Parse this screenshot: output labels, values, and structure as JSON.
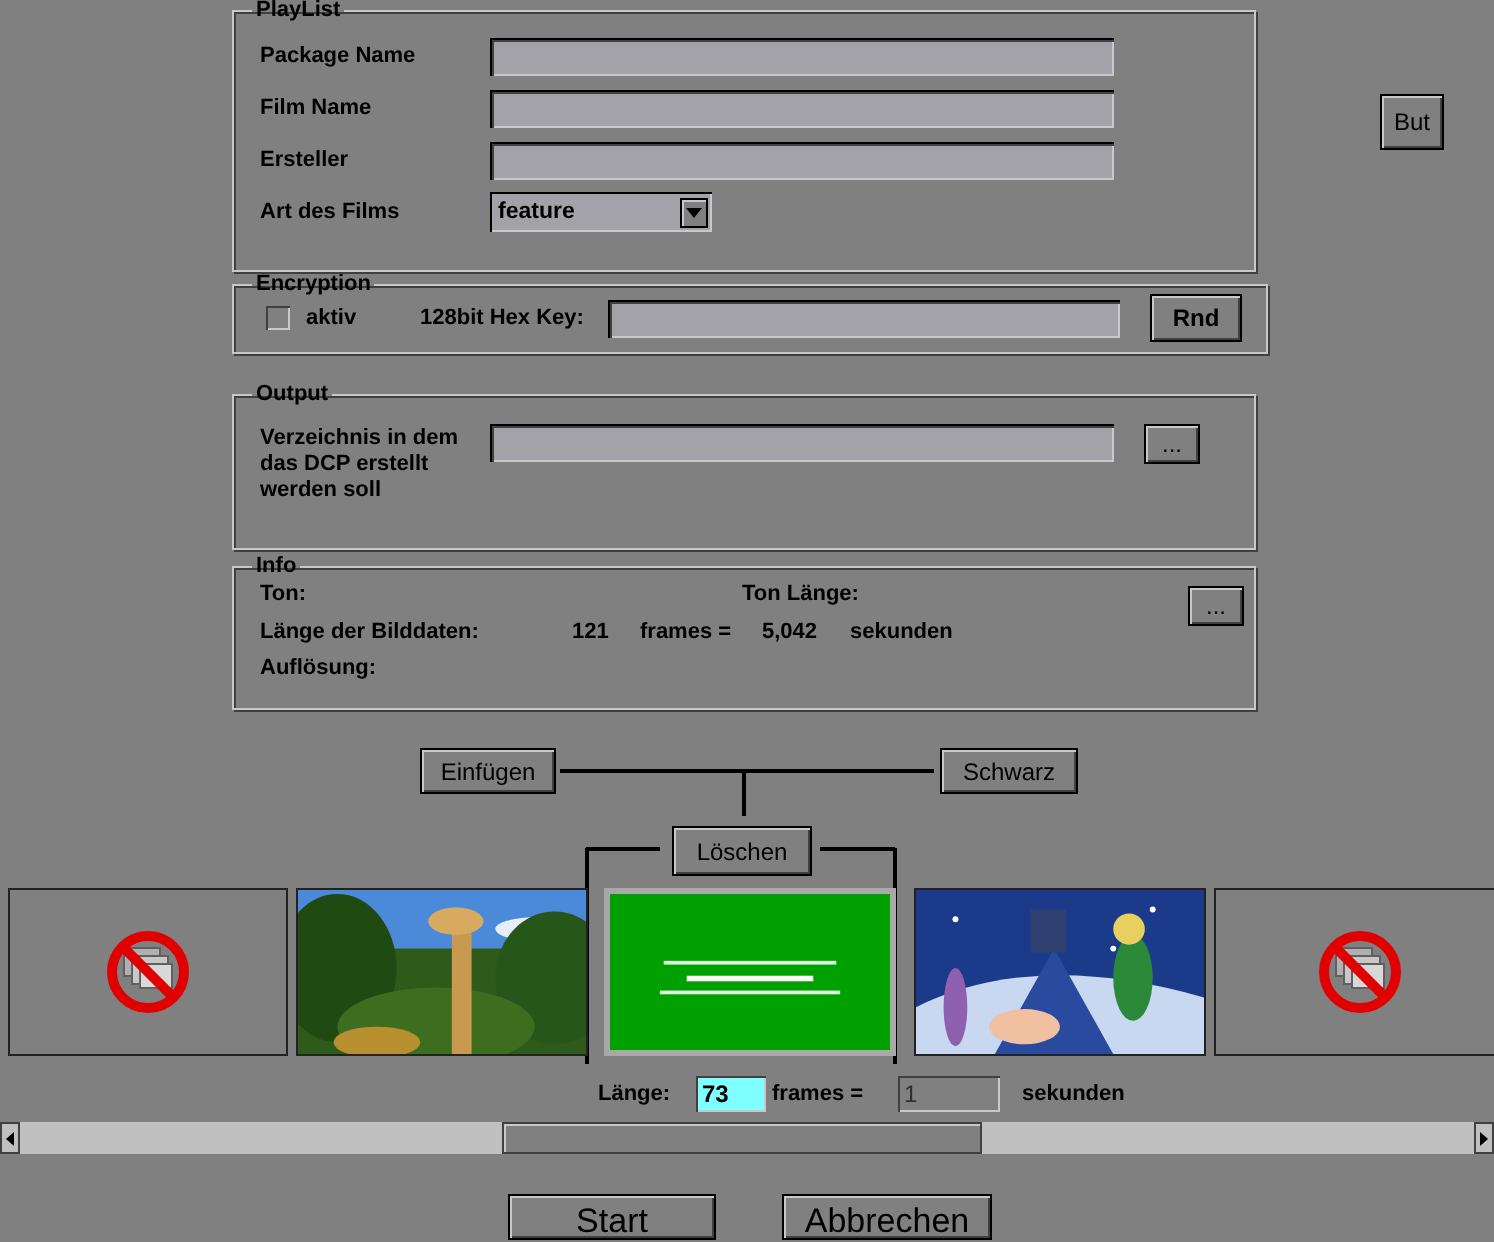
{
  "playlist": {
    "title": "PlayList",
    "fields": [
      {
        "label": "Package Name",
        "kind": "text"
      },
      {
        "label": "Film Name",
        "kind": "text"
      },
      {
        "label": "Ersteller",
        "kind": "text"
      },
      {
        "label": "Art des Films",
        "kind": "select",
        "value": "feature"
      }
    ]
  },
  "side_button": "But",
  "encryption": {
    "title": "Encryption",
    "checkbox": {
      "label": "aktiv",
      "checked": false
    },
    "key_label": "128bit Hex Key:",
    "button": "Rnd"
  },
  "output": {
    "title": "Output",
    "label": "Verzeichnis in dem das DCP erstellt werden soll",
    "button": "..."
  },
  "info": {
    "title": "Info",
    "button": "...",
    "sound_label": "Ton:",
    "sound_length_label": "Ton Länge:",
    "image_length_label": "Länge der Bilddaten:",
    "frames": "121",
    "frames_label": "frames =",
    "seconds": "5,042",
    "seconds_label": "sekunden",
    "resolution_label": "Auflösung:"
  },
  "timeline": {
    "insert_button": "Einfügen",
    "black_button": "Schwarz",
    "delete_button": "Löschen",
    "frames": [
      {
        "kind": "empty",
        "selected": false
      },
      {
        "kind": "picture",
        "selected": false
      },
      {
        "kind": "picture",
        "selected": true
      },
      {
        "kind": "picture",
        "selected": false
      },
      {
        "kind": "empty",
        "selected": false
      }
    ]
  },
  "length": {
    "label": "Länge:",
    "frames": "73",
    "frames_label": "frames =",
    "seconds": "1",
    "seconds_label": "sekunden"
  },
  "buttons": [
    "Start",
    "Abbrechen"
  ]
}
